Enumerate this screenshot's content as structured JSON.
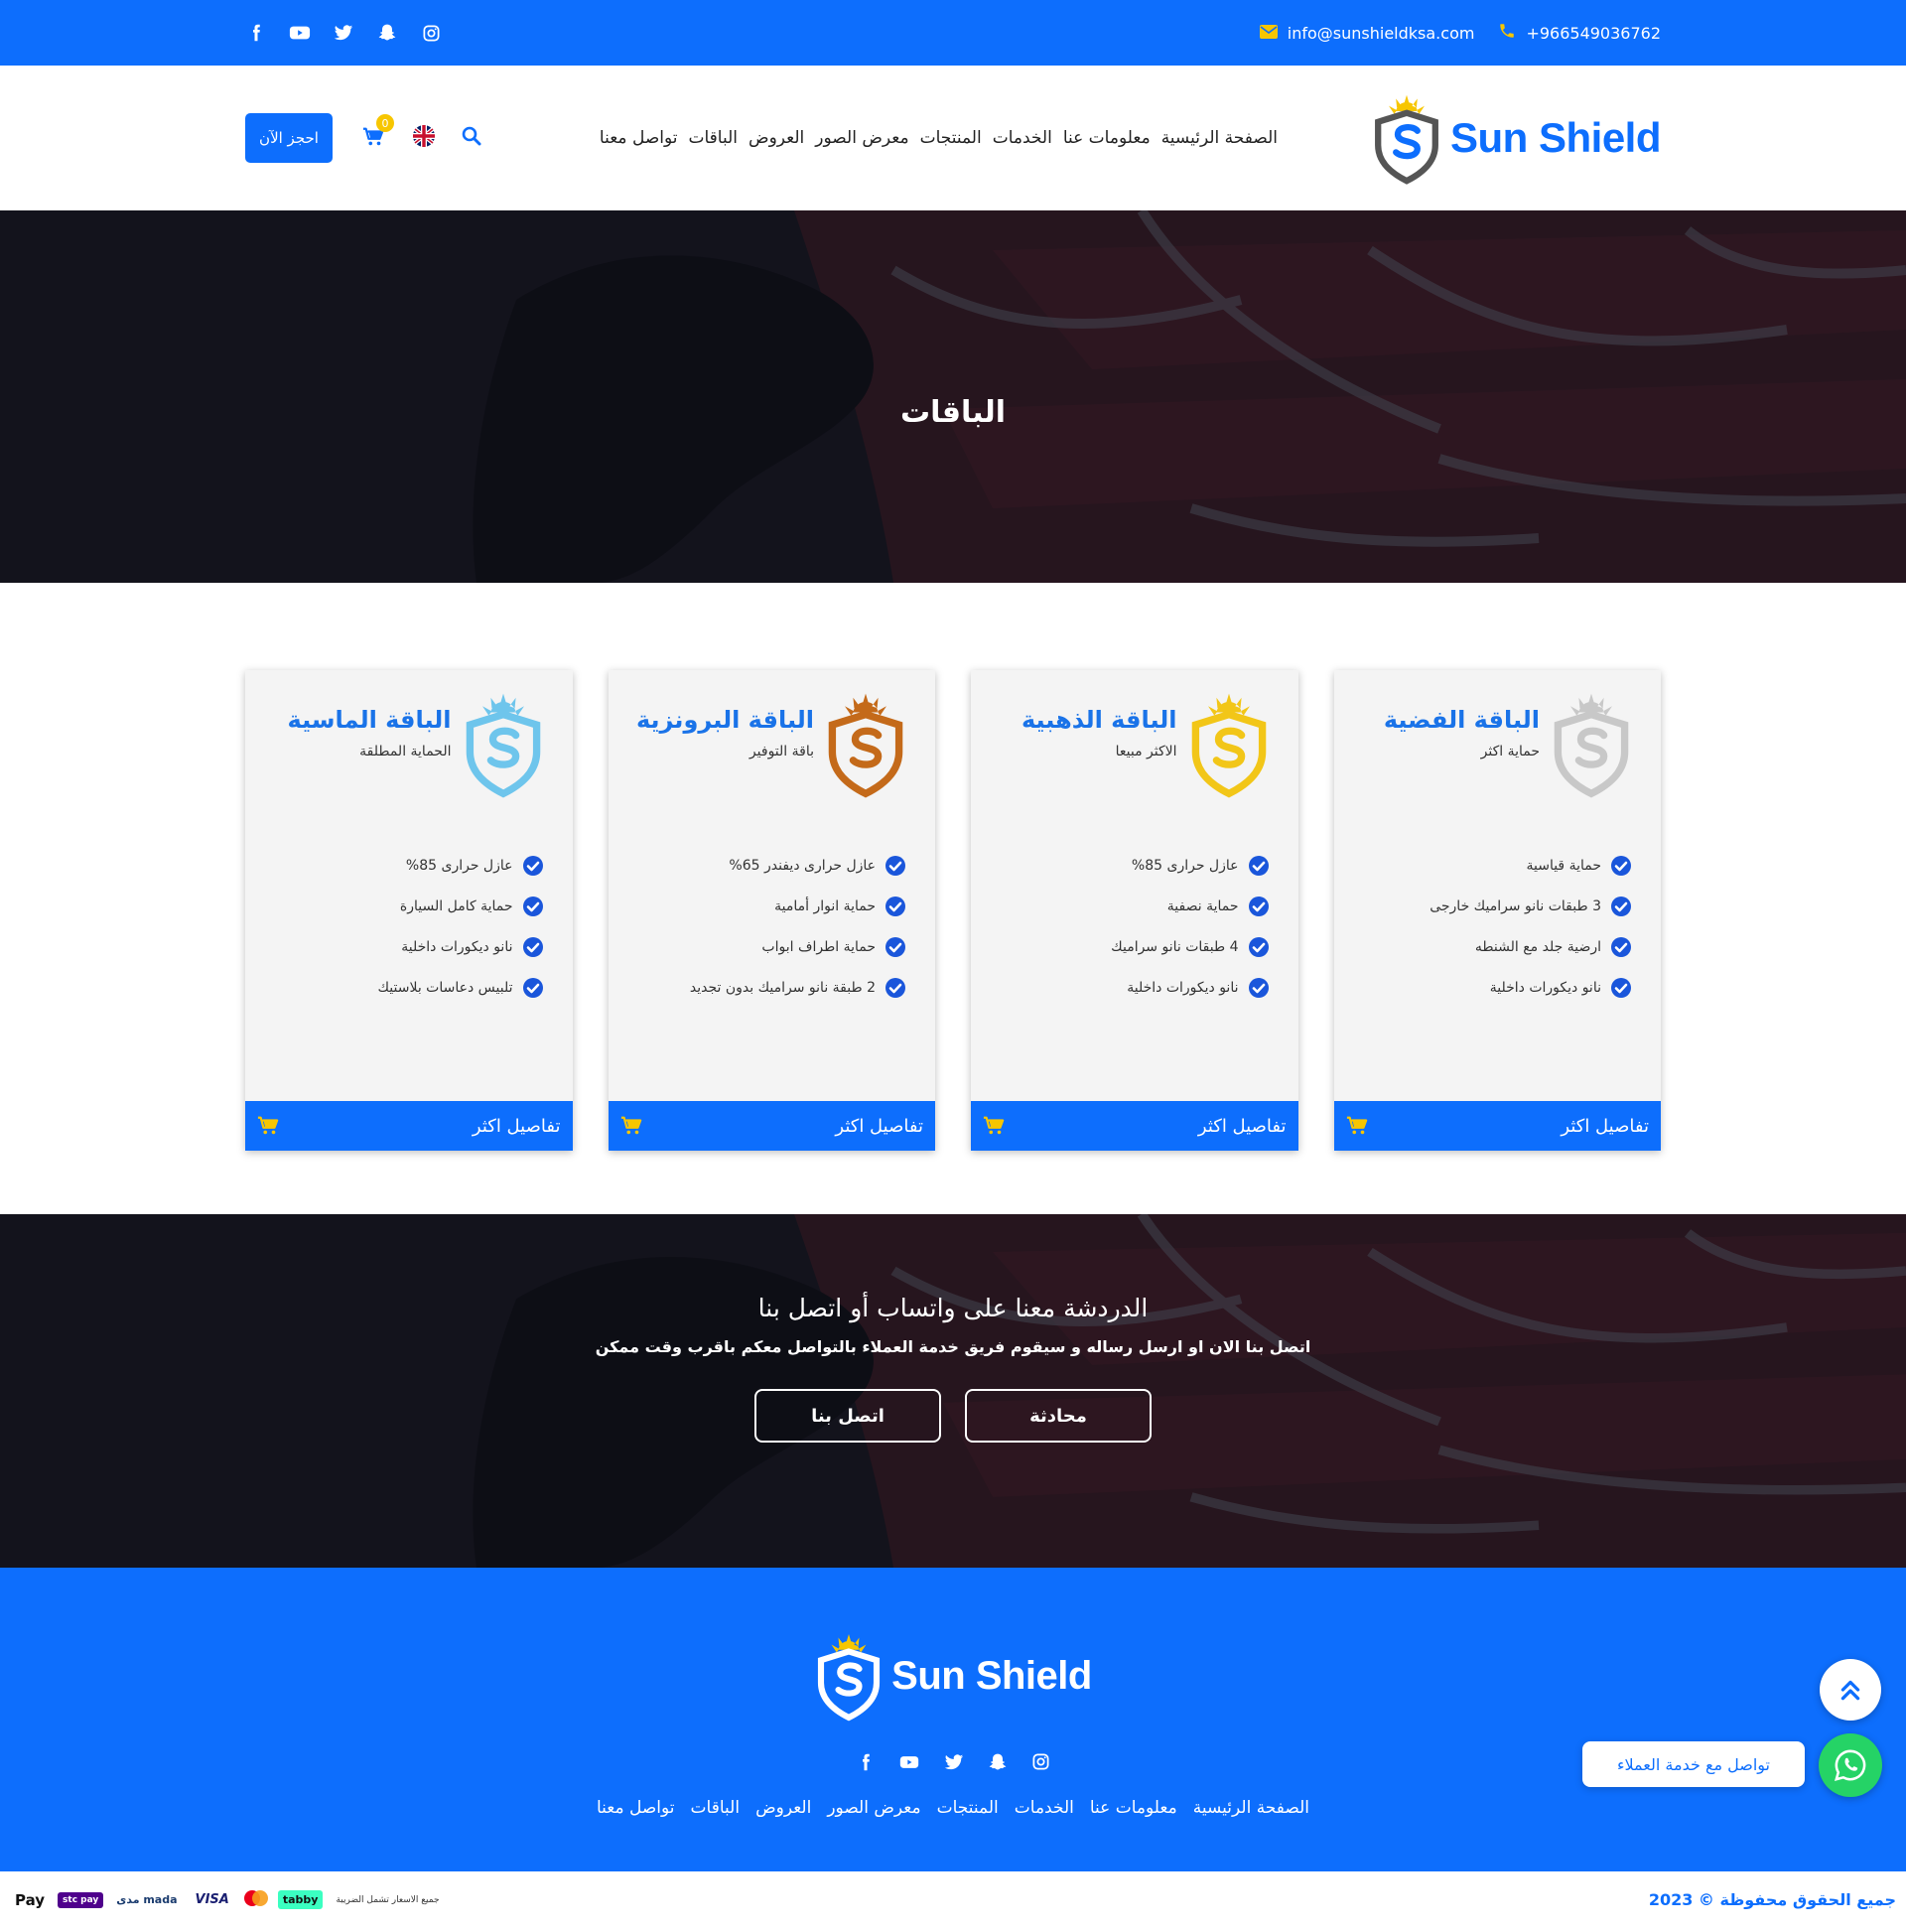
{
  "topbar": {
    "email": "info@sunshieldksa.com",
    "phone": "+966549036762",
    "social_icons": [
      "facebook-icon",
      "youtube-icon",
      "twitter-icon",
      "snapchat-icon",
      "instagram-icon"
    ]
  },
  "header": {
    "logo_text": "Sun Shield",
    "nav": [
      "الصفحة الرئيسية",
      "معلومات عنا",
      "الخدمات",
      "المنتجات",
      "معرض الصور",
      "العروض",
      "الباقات",
      "تواصل معنا"
    ],
    "book_button": "احجز الآن",
    "cart_count": "0",
    "language_icon": "uk-flag-icon",
    "search_icon": "search-icon"
  },
  "hero": {
    "title": "الباقات"
  },
  "packages": [
    {
      "title": "الباقة الفضية",
      "subtitle": "حماية اكثر",
      "shield_color": "#c8c8c8",
      "features": [
        "حماية قياسية",
        "3 طبقات نانو سراميك خارجى",
        "ارضية جلد مع الشنطه",
        "نانو ديكورات داخلية"
      ],
      "footer_label": "تفاصيل اكثر"
    },
    {
      "title": "الباقة الذهبية",
      "subtitle": "الاكثر مبيعا",
      "shield_color": "#f2c618",
      "features": [
        "عازل حرارى 85%",
        "حماية نصفية",
        "4 طبقات نانو سراميك",
        "نانو ديكورات داخلية"
      ],
      "footer_label": "تفاصيل اكثر"
    },
    {
      "title": "الباقة البرونزية",
      "subtitle": "باقة التوفير",
      "shield_color": "#c46a1a",
      "features": [
        "عازل حرارى ديفندر 65%",
        "حماية انوار أمامية",
        "حماية اطراف ابواب",
        "2 طبقة نانو سراميك بدون تجديد"
      ],
      "footer_label": "تفاصيل اكثر"
    },
    {
      "title": "الباقة الماسية",
      "subtitle": "الحماية المطلقة",
      "shield_color": "#6ec5ec",
      "features": [
        "عازل حرارى 85%",
        "حماية كامل السيارة",
        "نانو ديكورات داخلية",
        "تلبيس دعاسات بلاستيك"
      ],
      "footer_label": "تفاصيل اكثر"
    }
  ],
  "cta": {
    "title": "الدردشة معنا على واتساب أو اتصل بنا",
    "text": "اتصل بنا الان او ارسل رساله و سيقوم فريق خدمة العملاء بالتواصل معكم باقرب وقت ممكن",
    "chat_button": "محادثة",
    "call_button": "اتصل بنا"
  },
  "footer": {
    "logo_text": "Sun Shield",
    "nav": [
      "الصفحة الرئيسية",
      "معلومات عنا",
      "الخدمات",
      "المنتجات",
      "معرض الصور",
      "العروض",
      "الباقات",
      "تواصل معنا"
    ]
  },
  "bottombar": {
    "copyright": "جميع الحقوق محفوظة © 2023",
    "payments": [
      "Pay",
      "stc pay",
      "مدى mada",
      "VISA",
      "tabby",
      "جميع الاسعار تشمل الضريبة"
    ]
  },
  "floating": {
    "whatsapp_label": "تواصل مع خدمة العملاء"
  },
  "colors": {
    "primary": "#0d6efd",
    "accent": "#f7c600",
    "whatsapp": "#25d366"
  }
}
